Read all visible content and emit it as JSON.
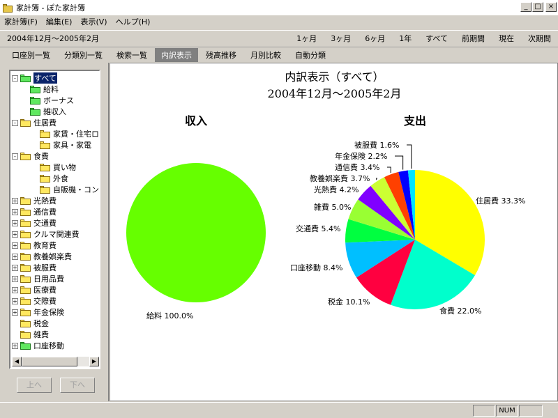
{
  "window": {
    "title": "家計簿 - ぽた家計簿"
  },
  "menu": [
    "家計簿(F)",
    "編集(E)",
    "表示(V)",
    "ヘルプ(H)"
  ],
  "period": {
    "label": "2004年12月～2005年2月",
    "buttons": [
      "1ヶ月",
      "3ヶ月",
      "6ヶ月",
      "1年",
      "すべて",
      "前期間",
      "現在",
      "次期間"
    ]
  },
  "tabs": [
    "口座別一覧",
    "分類別一覧",
    "検索一覧",
    "内訳表示",
    "残高推移",
    "月別比較",
    "自動分類"
  ],
  "active_tab": "内訳表示",
  "tree": [
    {
      "label": "すべて",
      "level": 0,
      "expander": "-",
      "color": "green",
      "selected": true
    },
    {
      "label": "給料",
      "level": 1,
      "expander": "",
      "color": "green"
    },
    {
      "label": "ボーナス",
      "level": 1,
      "expander": "",
      "color": "green"
    },
    {
      "label": "雑収入",
      "level": 1,
      "expander": "",
      "color": "green"
    },
    {
      "label": "住居費",
      "level": 0,
      "expander": "-",
      "color": "yellow"
    },
    {
      "label": "家賃・住宅ロ-",
      "level": 2,
      "expander": "",
      "color": "yellow"
    },
    {
      "label": "家具・家電",
      "level": 2,
      "expander": "",
      "color": "yellow"
    },
    {
      "label": "食費",
      "level": 0,
      "expander": "-",
      "color": "yellow"
    },
    {
      "label": "買い物",
      "level": 2,
      "expander": "",
      "color": "yellow"
    },
    {
      "label": "外食",
      "level": 2,
      "expander": "",
      "color": "yellow"
    },
    {
      "label": "自販機・コンビ",
      "level": 2,
      "expander": "",
      "color": "yellow"
    },
    {
      "label": "光熱費",
      "level": 0,
      "expander": "+",
      "color": "yellow"
    },
    {
      "label": "通信費",
      "level": 0,
      "expander": "+",
      "color": "yellow"
    },
    {
      "label": "交通費",
      "level": 0,
      "expander": "+",
      "color": "yellow"
    },
    {
      "label": "クルマ関連費",
      "level": 0,
      "expander": "+",
      "color": "yellow"
    },
    {
      "label": "教育費",
      "level": 0,
      "expander": "+",
      "color": "yellow"
    },
    {
      "label": "教養娯楽費",
      "level": 0,
      "expander": "+",
      "color": "yellow"
    },
    {
      "label": "被服費",
      "level": 0,
      "expander": "+",
      "color": "yellow"
    },
    {
      "label": "日用品費",
      "level": 0,
      "expander": "+",
      "color": "yellow"
    },
    {
      "label": "医療費",
      "level": 0,
      "expander": "+",
      "color": "yellow"
    },
    {
      "label": "交際費",
      "level": 0,
      "expander": "+",
      "color": "yellow"
    },
    {
      "label": "年金保険",
      "level": 0,
      "expander": "+",
      "color": "yellow"
    },
    {
      "label": "税金",
      "level": 0,
      "expander": "",
      "color": "yellow"
    },
    {
      "label": "雑費",
      "level": 0,
      "expander": "",
      "color": "yellow"
    },
    {
      "label": "口座移動",
      "level": 0,
      "expander": "+",
      "color": "green"
    }
  ],
  "nav": {
    "up": "上へ",
    "down": "下へ"
  },
  "status": {
    "num": "NUM"
  },
  "chart_data": {
    "title": "内訳表示（すべて）",
    "subtitle": "2004年12月～2005年2月",
    "charts": [
      {
        "type": "pie",
        "title": "収入",
        "slices": [
          {
            "label": "給料",
            "value": 100.0,
            "color": "#66ff00"
          }
        ]
      },
      {
        "type": "pie",
        "title": "支出",
        "slices": [
          {
            "label": "住居費",
            "value": 33.3,
            "color": "#ffff00"
          },
          {
            "label": "食費",
            "value": 22.0,
            "color": "#00ffcc"
          },
          {
            "label": "税金",
            "value": 10.1,
            "color": "#ff0040"
          },
          {
            "label": "口座移動",
            "value": 8.4,
            "color": "#00bfff"
          },
          {
            "label": "交通費",
            "value": 5.4,
            "color": "#00ff40"
          },
          {
            "label": "雑費",
            "value": 5.0,
            "color": "#99ff33"
          },
          {
            "label": "光熱費",
            "value": 4.2,
            "color": "#8000ff"
          },
          {
            "label": "教養娯楽費",
            "value": 3.7,
            "color": "#ccff33"
          },
          {
            "label": "通信費",
            "value": 3.4,
            "color": "#ff4000"
          },
          {
            "label": "年金保険",
            "value": 2.2,
            "color": "#0000ff"
          },
          {
            "label": "被服費",
            "value": 1.6,
            "color": "#00e5ff"
          }
        ]
      }
    ]
  }
}
